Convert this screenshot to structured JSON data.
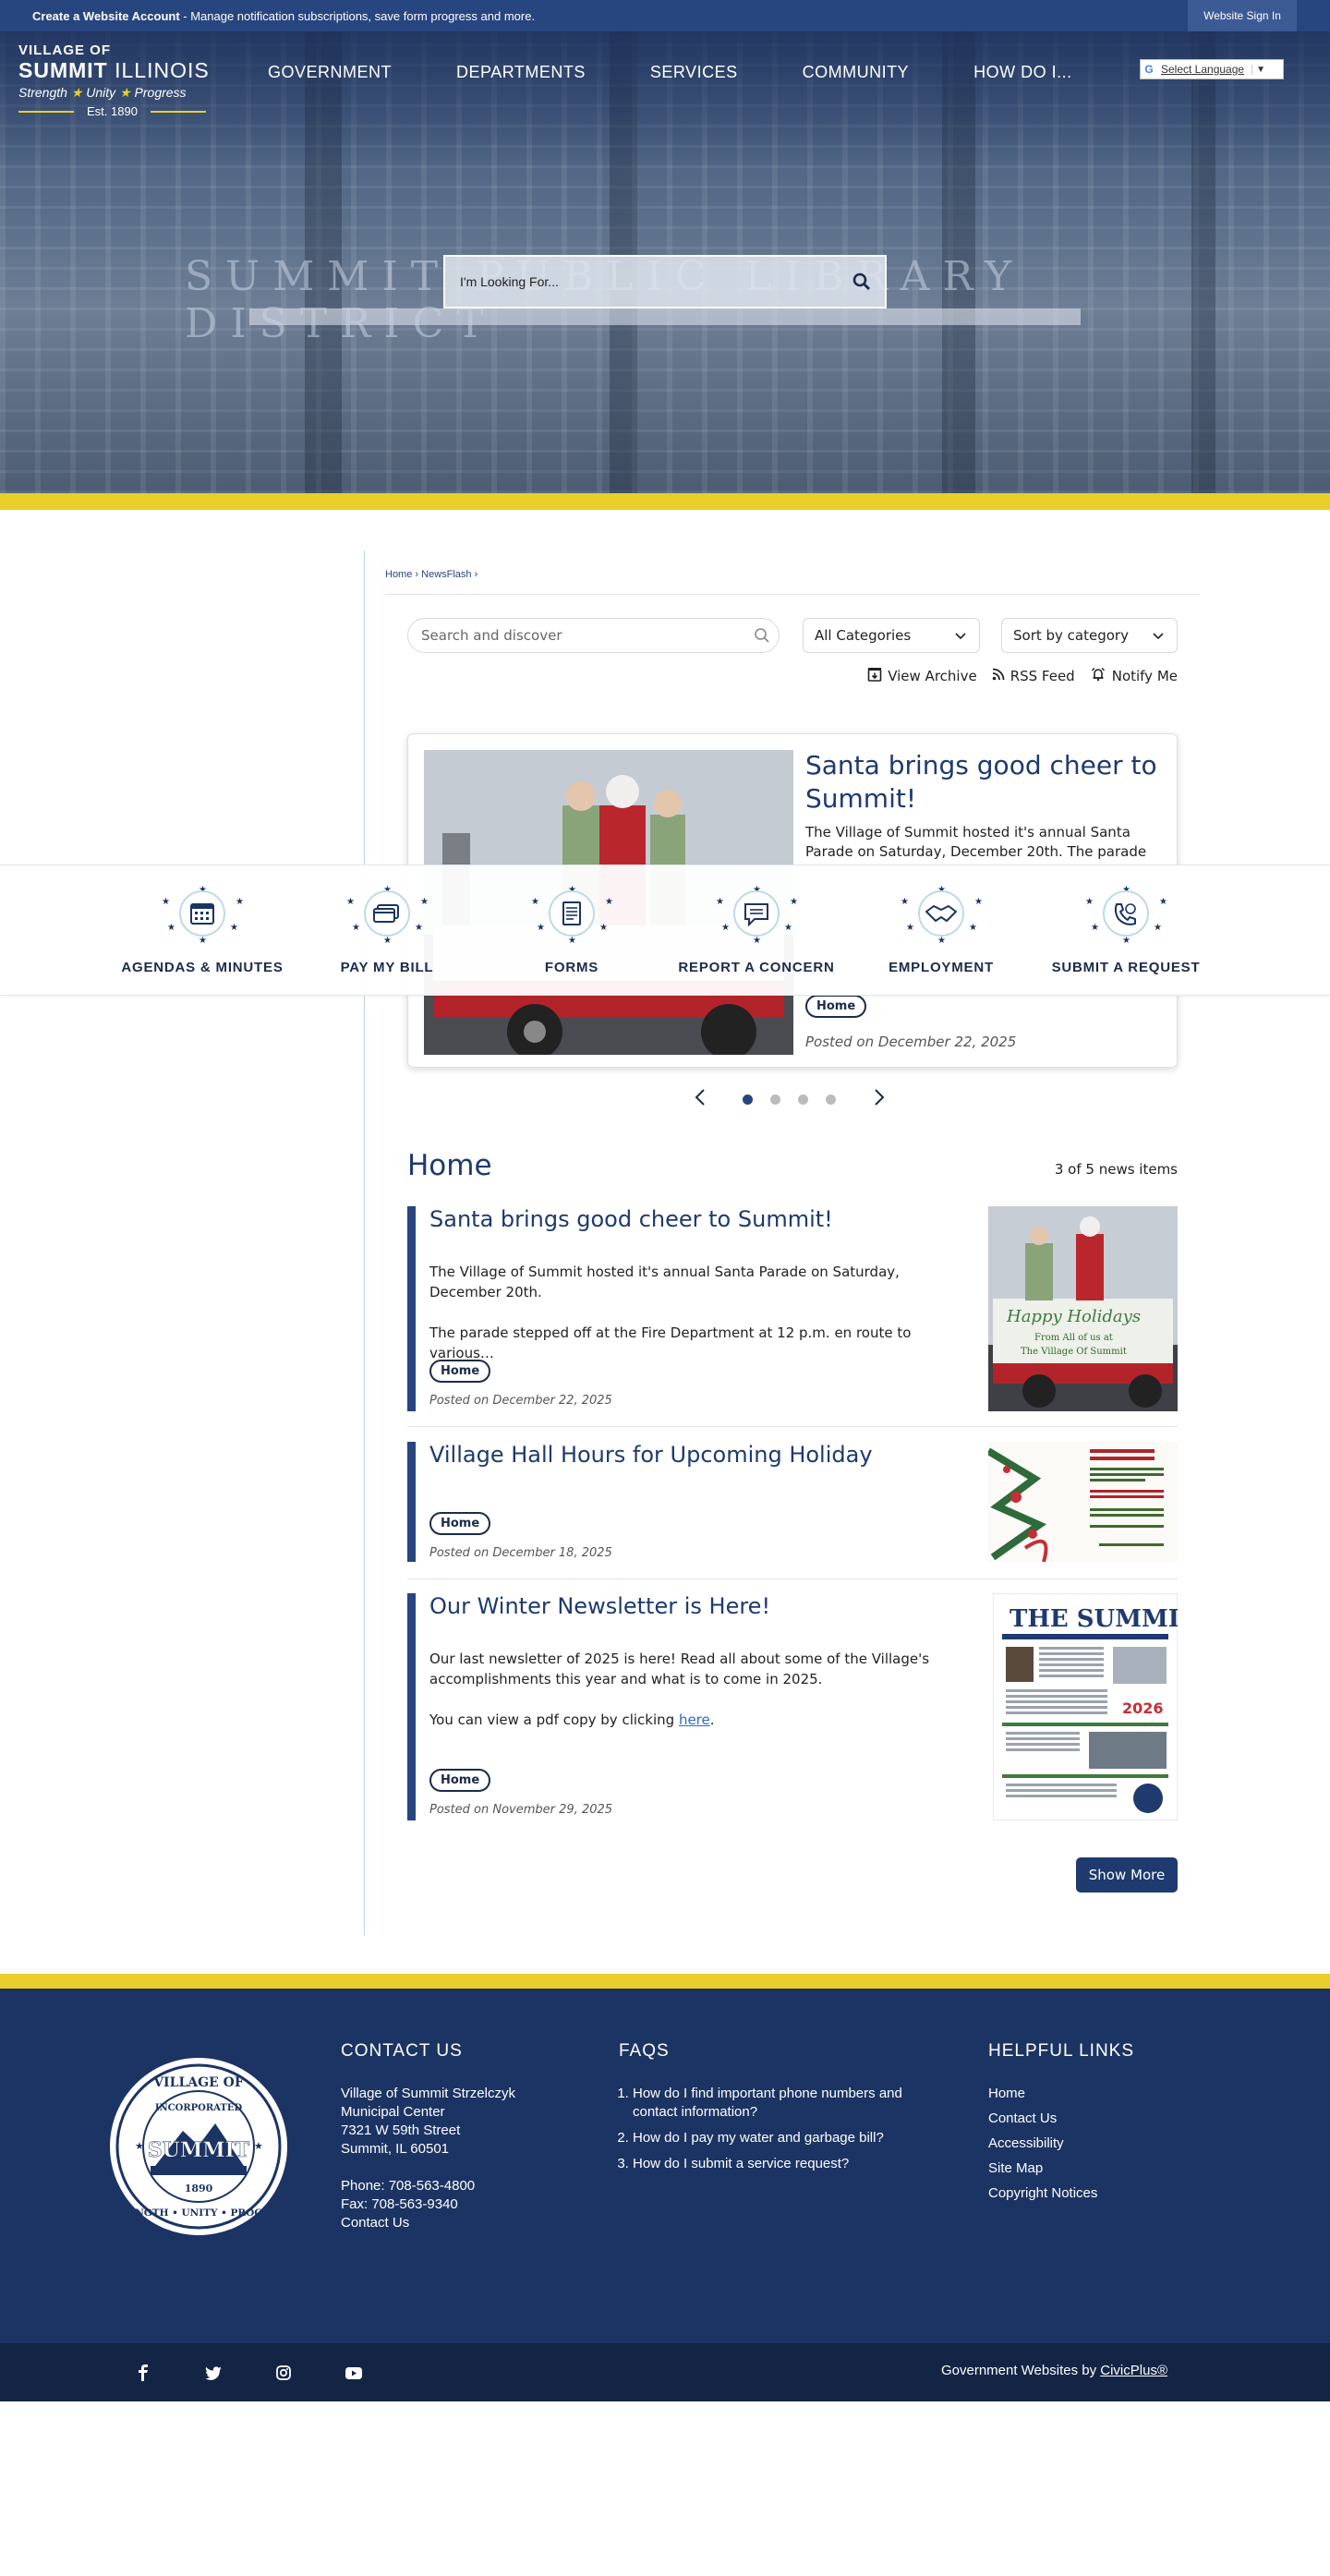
{
  "topbar": {
    "create_account": "Create a Website Account",
    "message": " - Manage notification subscriptions, save form progress and more.",
    "signin": "Website Sign In"
  },
  "logo": {
    "line1": "VILLAGE OF",
    "line2_bold": "SUMMIT",
    "line2_rest": " ILLINOIS",
    "motto_1": "Strength",
    "motto_2": "Unity",
    "motto_3": "Progress",
    "est": "Est. 1890"
  },
  "nav": [
    "GOVERNMENT",
    "DEPARTMENTS",
    "SERVICES",
    "COMMUNITY",
    "HOW DO I..."
  ],
  "translate": {
    "label": "Select Language"
  },
  "hero": {
    "search_placeholder": "I'm Looking For...",
    "sign_text": "SUMMIT PUBLIC LIBRARY DISTRICT"
  },
  "breadcrumb": {
    "home": "Home",
    "newsflash": "NewsFlash"
  },
  "filters": {
    "search_placeholder": "Search and discover",
    "categories": "All Categories",
    "sort": "Sort by category"
  },
  "actions": {
    "archive": "View Archive",
    "rss": "RSS Feed",
    "notify": "Notify Me"
  },
  "featured": {
    "title": "Santa brings good cheer to Summit!",
    "snippet": "The Village of Summit hosted it's annual Santa Parade on Saturday, December 20th. The parade stepped off at the Fire Department at 12 p.m.",
    "tag": "Home",
    "posted": "Posted on December 22, 2025"
  },
  "quicklinks": [
    {
      "label": "AGENDAS & MINUTES",
      "icon": "calendar-icon"
    },
    {
      "label": "PAY MY BILL",
      "icon": "credit-card-icon"
    },
    {
      "label": "FORMS",
      "icon": "document-icon"
    },
    {
      "label": "REPORT A CONCERN",
      "icon": "chat-icon"
    },
    {
      "label": "EMPLOYMENT",
      "icon": "handshake-icon"
    },
    {
      "label": "SUBMIT A REQUEST",
      "icon": "phone-icon"
    }
  ],
  "carousel": {
    "total": 4,
    "active": 1
  },
  "list": {
    "title": "Home",
    "count": "3 of 5 news items",
    "items": [
      {
        "title": "Santa brings good cheer to Summit!",
        "p1": "The Village of Summit hosted it's annual Santa Parade on Saturday, December 20th.",
        "p2": "The parade stepped off at the Fire Department at 12 p.m. en route to various…",
        "tag": "Home",
        "posted": "Posted on December 22, 2025",
        "img_text_1": "Happy Holidays",
        "img_text_2": "From All of us at",
        "img_text_3": "The Village Of Summit"
      },
      {
        "title": "Village Hall Hours for Upcoming Holiday",
        "tag": "Home",
        "posted": "Posted on December 18, 2025"
      },
      {
        "title": "Our Winter Newsletter is Here!",
        "p1": "Our last newsletter of 2025 is here! Read all about some of the Village's accomplishments this year and what is to come in 2025.",
        "p2_pre": "You can view a pdf copy by clicking ",
        "p2_link": "here",
        "p2_post": ".",
        "tag": "Home",
        "posted": "Posted on November 29, 2025",
        "img_title": "THE SUMMIT",
        "img_year": "2026"
      }
    ],
    "show_more": "Show More"
  },
  "footer": {
    "contact": {
      "title": "CONTACT US",
      "lines": [
        "Village of Summit Strzelczyk",
        "Municipal Center",
        "7321 W 59th Street",
        "Summit, IL 60501"
      ],
      "phone": "Phone: 708-563-4800",
      "fax": "Fax: 708-563-9340",
      "contact_link": "Contact Us"
    },
    "faqs": {
      "title": "FAQS",
      "items": [
        "How do I find important phone numbers and contact information?",
        "How do I pay my water and garbage bill?",
        "How do I submit a service request?"
      ]
    },
    "helpful": {
      "title": "HELPFUL LINKS",
      "items": [
        "Home",
        "Contact Us",
        "Accessibility",
        "Site Map",
        "Copyright Notices"
      ]
    },
    "seal": {
      "top": "VILLAGE OF",
      "incorporated": "INCORPORATED",
      "name": "SUMMIT",
      "year": "1890",
      "bottom": "STRENGTH • UNITY • PROGRESS"
    },
    "credit_pre": "Government Websites by ",
    "credit_link": "CivicPlus®"
  },
  "colors": {
    "navy": "#1c3463",
    "blue": "#27457f",
    "yellow": "#e9cf2a"
  }
}
